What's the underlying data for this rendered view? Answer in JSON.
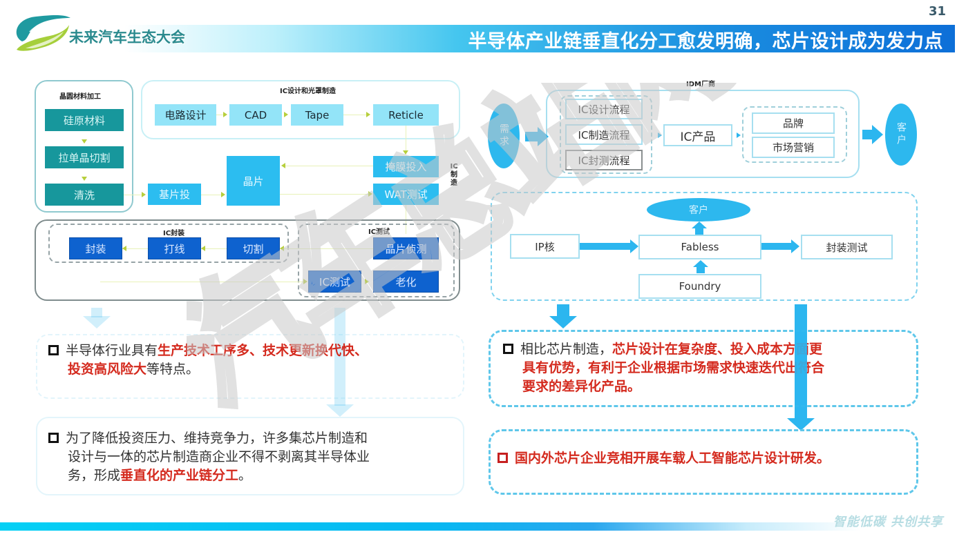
{
  "header": {
    "brand": "未来汽车生态大会",
    "title": "半导体产业链垂直化分工愈发明确，芯片设计成为发力点",
    "page_number": "31"
  },
  "left_diagram": {
    "wafer_section": {
      "label": "晶圆材料加工",
      "steps": [
        "硅原材料",
        "拉单晶切割",
        "清洗"
      ]
    },
    "design_section": {
      "label": "IC设计和光罩制造",
      "steps": [
        "电路设计",
        "CAD",
        "Tape",
        "Reticle"
      ]
    },
    "manufacturing": {
      "label": "IC制造",
      "substrate": "基片投",
      "wafer": "晶片",
      "mask_input": "掩膜投入",
      "wat_test": "WAT测试"
    },
    "packaging_section": {
      "label": "IC封装",
      "steps": [
        "封装",
        "打线",
        "切割"
      ]
    },
    "testing_section": {
      "label": "IC测试",
      "steps": [
        "晶片侦测",
        "IC测试",
        "老化"
      ]
    }
  },
  "right_diagram": {
    "idm": {
      "label": "IDM厂商",
      "demand": "需求",
      "processes": [
        "IC设计流程",
        "IC制造流程",
        "IC封测流程"
      ],
      "product": "IC产品",
      "outputs": [
        "品牌",
        "市场营销"
      ],
      "customer": "客户"
    },
    "fabless_model": {
      "customer": "客户",
      "ip_core": "IP核",
      "fabless": "Fabless",
      "foundry": "Foundry",
      "packaging_test": "封装测试"
    }
  },
  "bullets": {
    "left_1": {
      "prefix": "半导体行业具有",
      "highlight_1": "生产技术工序多、技术更新换代快、",
      "highlight_2": "投资高风险大",
      "suffix": "等特点。"
    },
    "left_2": {
      "line_1": "为了降低投资压力、维持竞争力，许多集芯片制造和",
      "line_2": "设计与一体的芯片制造商企业不得不剥离其半导体业",
      "line_3_prefix": "务，形成",
      "highlight": "垂直化的产业链分工",
      "suffix": "。"
    },
    "right_1": {
      "prefix": "相比芯片制造，",
      "highlight_1": "芯片设计在复杂度、投入成本方面更",
      "highlight_2": "具有优势，有利于企业根据市场需求快速迭代出符合",
      "highlight_3": "要求的差异化产品。"
    },
    "right_2": {
      "highlight": "国内外芯片企业竞相开展车载人工智能芯片设计研发。"
    }
  },
  "watermark": "汽车总站网",
  "footer": {
    "slogan": "智能低碳  共创共享"
  },
  "colors": {
    "teal": "#17979c",
    "light_cyan": "#93e4f8",
    "sky_blue": "#2cbdf0",
    "dark_blue": "#0e62cf",
    "highlight_red": "#d42a1e",
    "title_blue": "#0d6fd8"
  }
}
